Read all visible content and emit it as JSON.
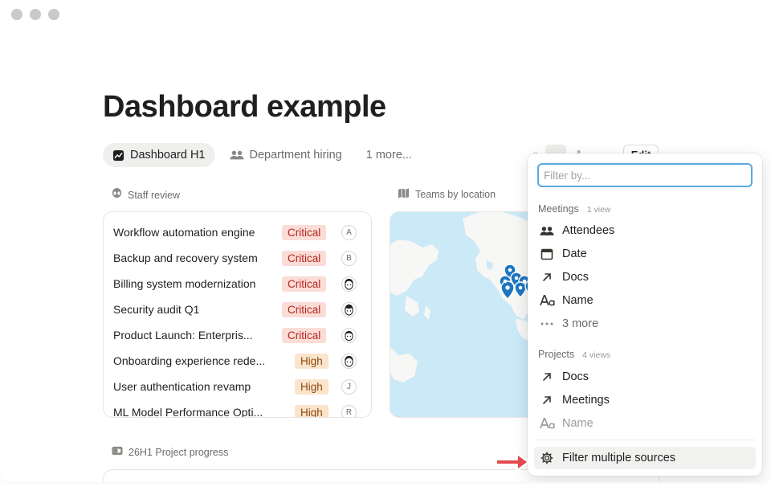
{
  "page": {
    "title": "Dashboard example"
  },
  "tabs": [
    {
      "label": "Dashboard H1",
      "icon": "chart-icon",
      "active": true
    },
    {
      "label": "Department hiring",
      "icon": "people-icon",
      "active": false
    },
    {
      "label": "1 more...",
      "icon": "",
      "active": false
    }
  ],
  "toolbar": {
    "edit_label": "Edit"
  },
  "staff_review": {
    "title": "Staff review",
    "icon": "alien-icon",
    "rows": [
      {
        "name": "Workflow automation engine",
        "priority": "Critical",
        "avatar": "A"
      },
      {
        "name": "Backup and recovery system",
        "priority": "Critical",
        "avatar": "B"
      },
      {
        "name": "Billing system modernization",
        "priority": "Critical",
        "avatar": ""
      },
      {
        "name": "Security audit Q1",
        "priority": "Critical",
        "avatar": ""
      },
      {
        "name": "Product Launch: Enterpris...",
        "priority": "Critical",
        "avatar": ""
      },
      {
        "name": "Onboarding experience rede...",
        "priority": "High",
        "avatar": ""
      },
      {
        "name": "User authentication revamp",
        "priority": "High",
        "avatar": "J"
      },
      {
        "name": "ML Model Performance Opti...",
        "priority": "High",
        "avatar": "R"
      }
    ]
  },
  "teams_by_location": {
    "title": "Teams by location",
    "icon": "map-icon"
  },
  "project_progress": {
    "title": "26H1 Project progress",
    "icon": "progress-icon"
  },
  "filter_panel": {
    "placeholder": "Filter by...",
    "meetings": {
      "label": "Meetings",
      "count": "1 view",
      "items": [
        {
          "label": "Attendees",
          "icon": "people-icon"
        },
        {
          "label": "Date",
          "icon": "calendar-icon"
        },
        {
          "label": "Docs",
          "icon": "relation-arrow-icon"
        },
        {
          "label": "Name",
          "icon": "text-aa-icon"
        },
        {
          "label": "3 more",
          "icon": "ellipsis-icon"
        }
      ]
    },
    "projects": {
      "label": "Projects",
      "count": "4 views",
      "items": [
        {
          "label": "Docs",
          "icon": "relation-arrow-icon"
        },
        {
          "label": "Meetings",
          "icon": "relation-arrow-icon"
        },
        {
          "label": "Name",
          "icon": "text-aa-icon"
        }
      ]
    },
    "footer_label": "Filter multiple sources",
    "footer_icon": "gear-icon"
  },
  "colors": {
    "critical_bg": "#fbdcd7",
    "critical_text": "#b3261e",
    "high_bg": "#fbe4cc",
    "high_text": "#8a4b10",
    "focus_ring": "#5aa8e0",
    "map_water": "#cbe9f7",
    "pin": "#1d76c2",
    "pointer_arrow": "#e5484d"
  }
}
